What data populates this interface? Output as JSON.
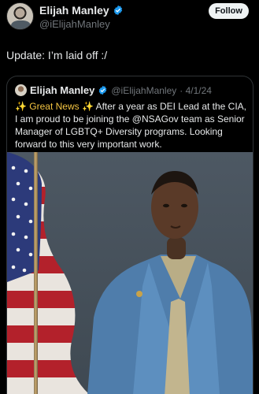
{
  "header": {
    "name": "Elijah Manley",
    "handle": "@iElijahManley",
    "follow_label": "Follow"
  },
  "tweet": {
    "text": "Update: I’m laid off :/"
  },
  "quote": {
    "name": "Elijah Manley",
    "handle": "@iElijahManley",
    "date": "· 4/1/24",
    "line1_a": "✨ Great News ✨",
    "line1_b": " After a year as DEI Lead at the CIA,",
    "line2": "I am proud to be joining the @NSAGov team as Senior",
    "line3": "Manager of LGBTQ+ Diversity programs. Looking",
    "line4": "forward to this very important work."
  },
  "colors": {
    "background": "#000000",
    "verified_blue": "#1d9bf0",
    "text": "#e7e9ea",
    "muted": "#71767b",
    "follow_bg": "#eff3f4"
  },
  "icons": {
    "verified": "verified-badge-icon"
  }
}
